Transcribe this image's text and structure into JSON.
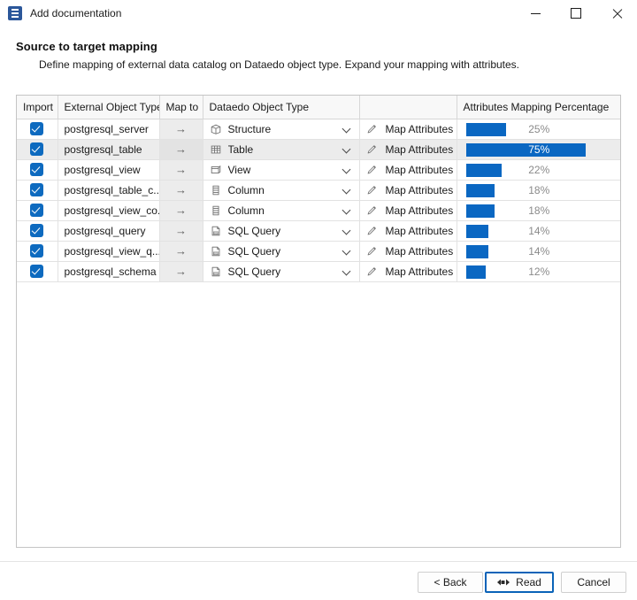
{
  "window": {
    "title": "Add documentation",
    "icon": "document-stack-icon",
    "controls": {
      "minimize": "minimize-icon",
      "maximize": "maximize-icon",
      "close": "close-icon"
    }
  },
  "header": {
    "title": "Source to target mapping",
    "description": "Define mapping of external data catalog on Dataedo object type. Expand your mapping with attributes."
  },
  "grid": {
    "columns": [
      {
        "key": "import",
        "label": "Import"
      },
      {
        "key": "ext",
        "label": "External Object Type"
      },
      {
        "key": "mapto",
        "label": "Map to"
      },
      {
        "key": "dataedo",
        "label": "Dataedo Object Type"
      },
      {
        "key": "attr",
        "label": ""
      },
      {
        "key": "pct",
        "label": "Attributes Mapping Percentage"
      }
    ],
    "arrow_glyph": "→",
    "map_attributes_label": "Map Attributes",
    "rows": [
      {
        "import": true,
        "external": "postgresql_server",
        "target": "Structure",
        "target_icon": "structure-icon",
        "attributes": "Map Attributes",
        "percent": 25,
        "percent_label": "25%",
        "selected": false
      },
      {
        "import": true,
        "external": "postgresql_table",
        "target": "Table",
        "target_icon": "table-icon",
        "attributes": "Map Attributes",
        "percent": 75,
        "percent_label": "75%",
        "selected": true
      },
      {
        "import": true,
        "external": "postgresql_view",
        "target": "View",
        "target_icon": "view-icon",
        "attributes": "Map Attributes",
        "percent": 22,
        "percent_label": "22%",
        "selected": false
      },
      {
        "import": true,
        "external": "postgresql_table_c...",
        "target": "Column",
        "target_icon": "column-icon",
        "attributes": "Map Attributes",
        "percent": 18,
        "percent_label": "18%",
        "selected": false
      },
      {
        "import": true,
        "external": "postgresql_view_co...",
        "target": "Column",
        "target_icon": "column-icon",
        "attributes": "Map Attributes",
        "percent": 18,
        "percent_label": "18%",
        "selected": false
      },
      {
        "import": true,
        "external": "postgresql_query",
        "target": "SQL Query",
        "target_icon": "sql-query-icon",
        "attributes": "Map Attributes",
        "percent": 14,
        "percent_label": "14%",
        "selected": false
      },
      {
        "import": true,
        "external": "postgresql_view_q...",
        "target": "SQL Query",
        "target_icon": "sql-query-icon",
        "attributes": "Map Attributes",
        "percent": 14,
        "percent_label": "14%",
        "selected": false
      },
      {
        "import": true,
        "external": "postgresql_schema",
        "target": "SQL Query",
        "target_icon": "sql-query-icon",
        "attributes": "Map Attributes",
        "percent": 12,
        "percent_label": "12%",
        "selected": false
      }
    ]
  },
  "footer": {
    "back_label": "< Back",
    "read_label": "Read",
    "read_icon": "read-connect-icon",
    "cancel_label": "Cancel"
  },
  "colors": {
    "accent": "#0a67c2",
    "checkbox": "#0d6abf",
    "default_button_border": "#0a63b8",
    "selected_row": "#ececec"
  }
}
